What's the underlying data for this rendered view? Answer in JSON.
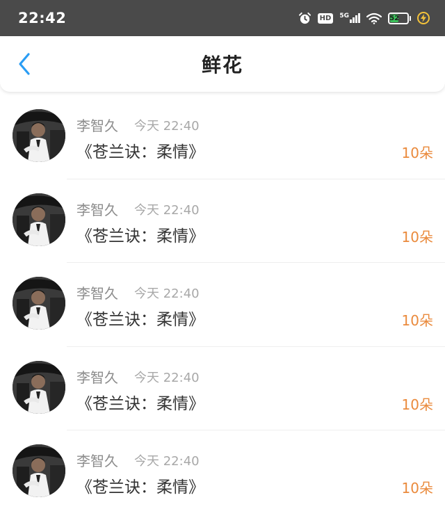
{
  "status_bar": {
    "time": "22:42",
    "hd_label": "HD",
    "network_label": "5G",
    "battery_level": "52",
    "icons": [
      "alarm-icon",
      "hd-icon",
      "signal-5g-icon",
      "wifi-icon",
      "battery-icon",
      "charging-icon"
    ]
  },
  "header": {
    "back_icon": "chevron-left-icon",
    "title": "鲜花",
    "accent_color": "#2a9df4"
  },
  "colors": {
    "count": "#ea8a3c",
    "name": "#8c8c8c",
    "time": "#a8a8a8",
    "gift": "#333333"
  },
  "items": [
    {
      "user": "李智久",
      "time": "今天 22:40",
      "gift": "《苍兰诀：柔情》",
      "count": "10朵"
    },
    {
      "user": "李智久",
      "time": "今天 22:40",
      "gift": "《苍兰诀：柔情》",
      "count": "10朵"
    },
    {
      "user": "李智久",
      "time": "今天 22:40",
      "gift": "《苍兰诀：柔情》",
      "count": "10朵"
    },
    {
      "user": "李智久",
      "time": "今天 22:40",
      "gift": "《苍兰诀：柔情》",
      "count": "10朵"
    },
    {
      "user": "李智久",
      "time": "今天 22:40",
      "gift": "《苍兰诀：柔情》",
      "count": "10朵"
    }
  ]
}
